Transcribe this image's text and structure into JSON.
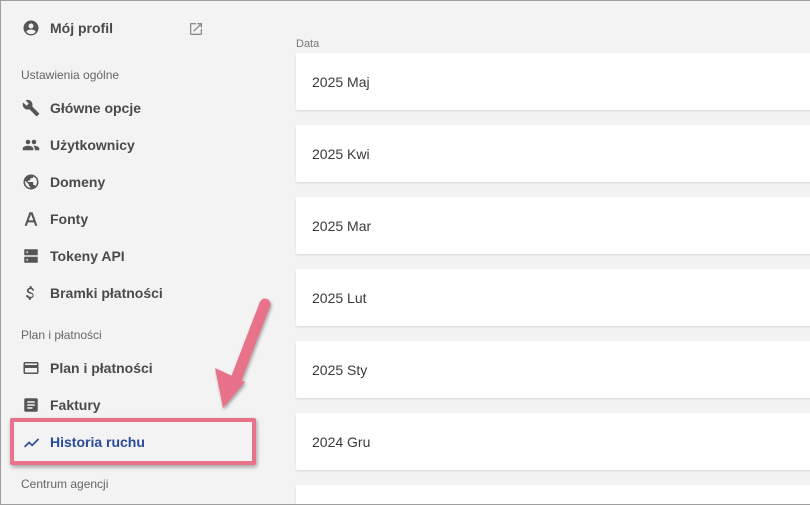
{
  "sidebar": {
    "profile": {
      "label": "Mój profil"
    },
    "sections": {
      "general": "Ustawienia ogólne",
      "billing": "Plan i płatności",
      "agency": "Centrum agencji"
    },
    "items": [
      {
        "label": "Główne opcje",
        "icon": "wrench-icon"
      },
      {
        "label": "Użytkownicy",
        "icon": "people-icon"
      },
      {
        "label": "Domeny",
        "icon": "globe-icon"
      },
      {
        "label": "Fonty",
        "icon": "font-icon"
      },
      {
        "label": "Tokeny API",
        "icon": "server-icon"
      },
      {
        "label": "Bramki płatności",
        "icon": "dollar-icon"
      },
      {
        "label": "Plan i płatności",
        "icon": "credit-card-icon"
      },
      {
        "label": "Faktury",
        "icon": "document-icon"
      },
      {
        "label": "Historia ruchu",
        "icon": "trend-icon",
        "active": true
      }
    ]
  },
  "main": {
    "column_header": "Data",
    "rows": [
      "2025 Maj",
      "2025 Kwi",
      "2025 Mar",
      "2025 Lut",
      "2025 Sty",
      "2024 Gru"
    ]
  },
  "colors": {
    "active": "#2b4a9b",
    "highlight": "#e8728a",
    "background": "#f3f3f3"
  }
}
